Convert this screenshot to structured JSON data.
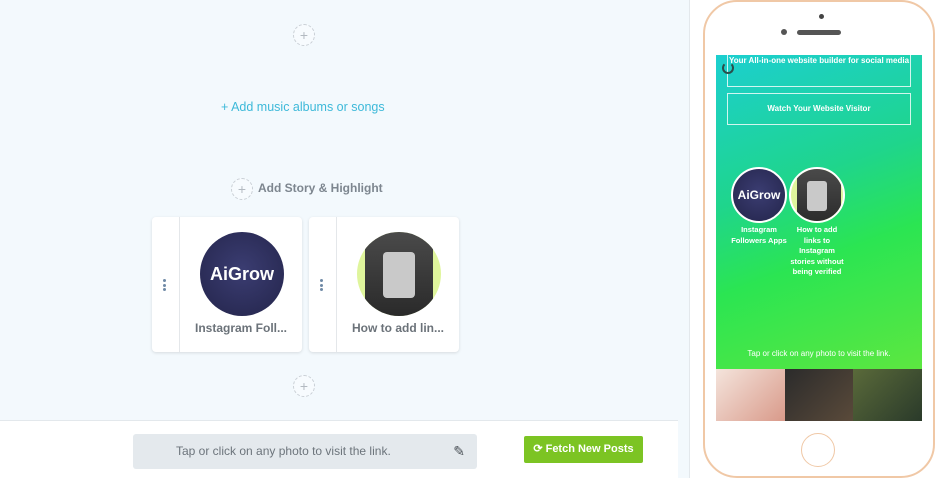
{
  "editor": {
    "add_music_label": "+ Add music albums or songs",
    "add_story_label": "Add Story & Highlight",
    "cards": [
      {
        "title": "Instagram Foll...",
        "thumb_text": "AiGrow"
      },
      {
        "title": "How to add lin...",
        "thumb_text": ""
      }
    ]
  },
  "bottom": {
    "link_text": "Tap or click on any photo to visit the link.",
    "fetch_button": "Fetch New Posts"
  },
  "phone": {
    "button1": "Your All-in-one website builder for social media",
    "button2": "Watch Your Website Visitor",
    "stories": [
      {
        "thumb_text": "AiGrow",
        "label": "Instagram Followers Apps"
      },
      {
        "thumb_text": "",
        "label": "How to add links to Instagram stories without being verified"
      }
    ],
    "tap_text": "Tap or click on any photo to visit the link."
  },
  "colors": {
    "accent": "#3db9d9",
    "fetch_green": "#7cc423",
    "phone_frame": "#f0c8a6"
  }
}
